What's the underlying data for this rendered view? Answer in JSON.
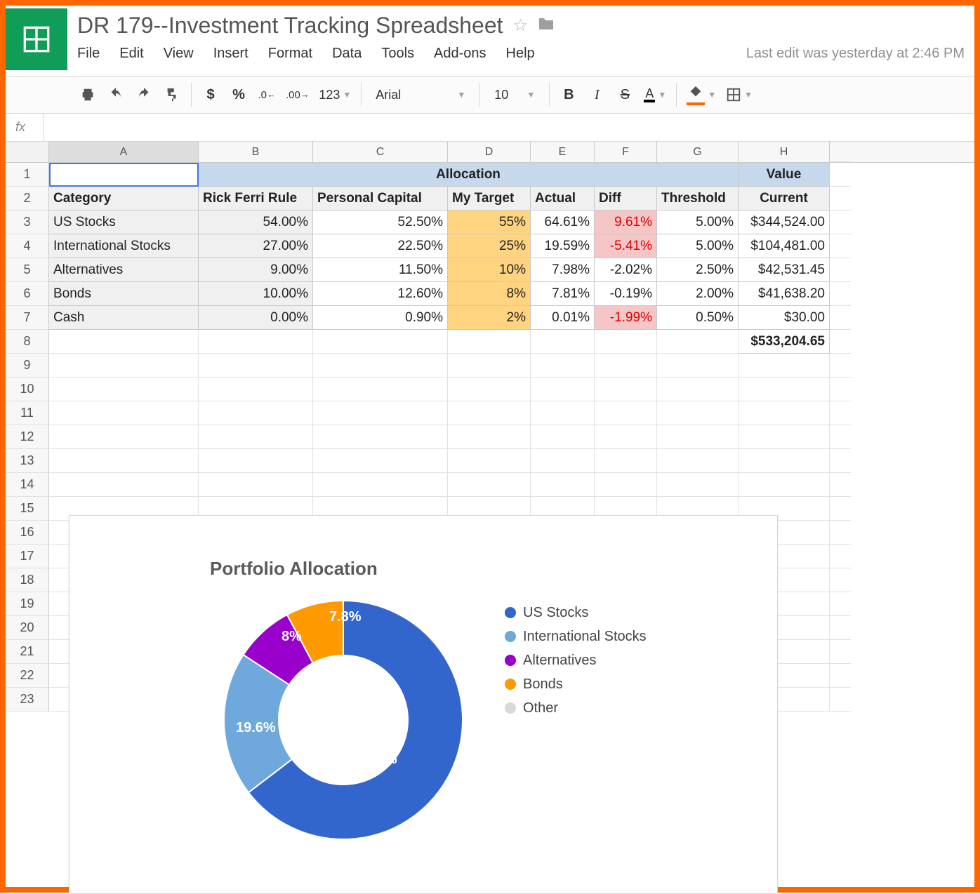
{
  "doc": {
    "title": "DR 179--Investment Tracking Spreadsheet",
    "last_edit": "Last edit was yesterday at 2:46 PM"
  },
  "menu": [
    "File",
    "Edit",
    "View",
    "Insert",
    "Format",
    "Data",
    "Tools",
    "Add-ons",
    "Help"
  ],
  "toolbar": {
    "currency": "$",
    "percent": "%",
    "dec_dec": ".0←",
    "inc_dec": ".00→",
    "num_fmt": "123",
    "font": "Arial",
    "size": "10",
    "bold": "B",
    "italic": "I",
    "strike": "S",
    "text_color": "A"
  },
  "formula": {
    "label": "fx",
    "value": ""
  },
  "columns": [
    "A",
    "B",
    "C",
    "D",
    "E",
    "F",
    "G",
    "H"
  ],
  "rows": [
    1,
    2,
    3,
    4,
    5,
    6,
    7,
    8,
    9,
    10,
    11,
    12,
    13,
    14,
    15,
    16,
    17,
    18,
    19,
    20,
    21,
    22,
    23
  ],
  "table": {
    "header1": {
      "allocation": "Allocation",
      "value": "Value"
    },
    "header2": [
      "Category",
      "Rick Ferri Rule",
      "Personal Capital",
      "My Target",
      "Actual",
      "Diff",
      "Threshold",
      "Current"
    ],
    "categories": [
      "US Stocks",
      "International Stocks",
      "Alternatives",
      "Bonds",
      "Cash"
    ],
    "rick_ferri": [
      "54.00%",
      "27.00%",
      "9.00%",
      "10.00%",
      "0.00%"
    ],
    "personal_capital": [
      "52.50%",
      "22.50%",
      "11.50%",
      "12.60%",
      "0.90%"
    ],
    "my_target": [
      "55%",
      "25%",
      "10%",
      "8%",
      "2%"
    ],
    "actual": [
      "64.61%",
      "19.59%",
      "7.98%",
      "7.81%",
      "0.01%"
    ],
    "diff": [
      "9.61%",
      "-5.41%",
      "-2.02%",
      "-0.19%",
      "-1.99%"
    ],
    "diff_red": [
      true,
      true,
      false,
      false,
      true
    ],
    "threshold": [
      "5.00%",
      "5.00%",
      "2.50%",
      "2.00%",
      "0.50%"
    ],
    "current": [
      "$344,524.00",
      "$104,481.00",
      "$42,531.45",
      "$41,638.20",
      "$30.00"
    ],
    "total": "$533,204.65"
  },
  "chart_data": {
    "type": "pie",
    "title": "Portfolio Allocation",
    "series": [
      {
        "name": "US Stocks",
        "value": 64.6,
        "color": "#3366cc"
      },
      {
        "name": "International Stocks",
        "value": 19.6,
        "color": "#6fa8dc"
      },
      {
        "name": "Alternatives",
        "value": 8.0,
        "color": "#9900cc"
      },
      {
        "name": "Bonds",
        "value": 7.8,
        "color": "#ff9900"
      },
      {
        "name": "Other",
        "value": 0.0,
        "color": "#d9d9d9"
      }
    ],
    "labels": [
      "64.6%",
      "19.6%",
      "8%",
      "7.8%"
    ]
  }
}
